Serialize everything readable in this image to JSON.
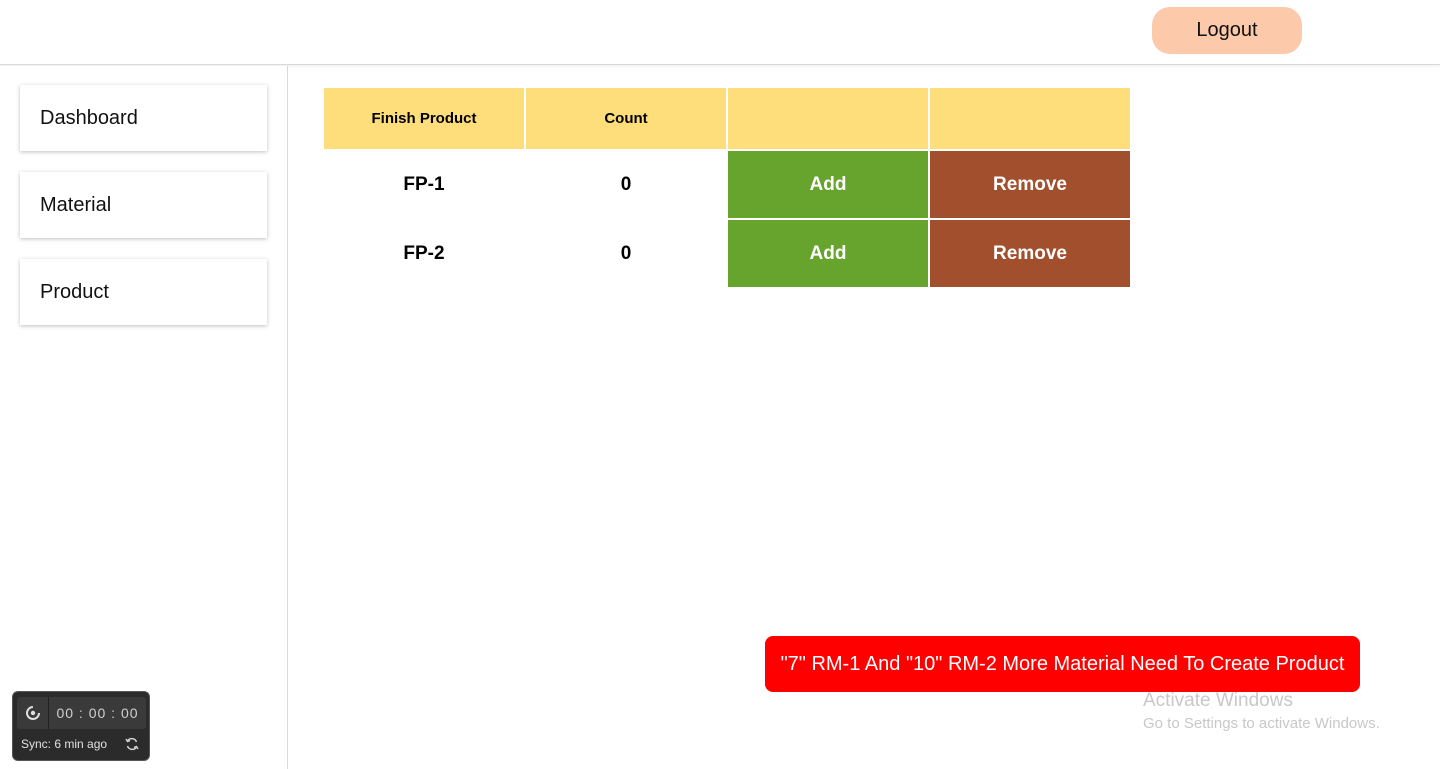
{
  "header": {
    "logout_label": "Logout"
  },
  "sidebar": {
    "items": [
      {
        "label": "Dashboard"
      },
      {
        "label": "Material"
      },
      {
        "label": "Product"
      }
    ]
  },
  "table": {
    "headers": [
      "Finish Product",
      "Count",
      "",
      ""
    ],
    "rows": [
      {
        "product": "FP-1",
        "count": "0",
        "add_label": "Add",
        "remove_label": "Remove"
      },
      {
        "product": "FP-2",
        "count": "0",
        "add_label": "Add",
        "remove_label": "Remove"
      }
    ]
  },
  "toast": {
    "message": "\"7\" RM-1 And \"10\" RM-2 More Material Need To Create Product"
  },
  "watermark": {
    "title": "Activate Windows",
    "subtitle": "Go to Settings to activate Windows."
  },
  "timer_widget": {
    "time": "00 : 00 : 00",
    "sync": "Sync: 6 min ago"
  },
  "colors": {
    "logout_bg": "#fcc9ab",
    "header_bg": "#fedd7b",
    "add_bg": "#67a42d",
    "remove_bg": "#a24f2d",
    "toast_bg": "#ff0000"
  }
}
